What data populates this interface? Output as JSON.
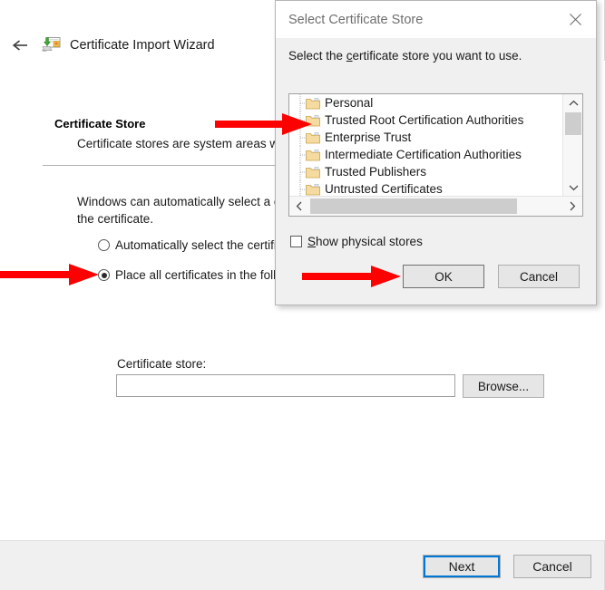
{
  "wizard": {
    "title": "Certificate Import Wizard",
    "back_icon": "back-arrow-icon",
    "app_icon": "certificate-import-icon",
    "heading": "Certificate Store",
    "subtext": "Certificate stores are system areas w",
    "intro_text": "Windows can automatically select a c\nthe certificate.",
    "radios": [
      {
        "label": "Automatically select the certifi",
        "checked": false
      },
      {
        "label": "Place all certificates in the follo",
        "checked": true
      }
    ],
    "cert_store_label": "Certificate store:",
    "cert_store_value": "",
    "cert_store_placeholder": "",
    "browse_label": "Browse...",
    "footer": {
      "next_label": "Next",
      "cancel_label": "Cancel"
    }
  },
  "dialog": {
    "title": "Select Certificate Store",
    "close_icon": "close-icon",
    "instruction_before": "Select the ",
    "instruction_accel": "c",
    "instruction_after": "ertificate store you want to use.",
    "tree_items": [
      {
        "label": "Personal",
        "icon": "folder-icon"
      },
      {
        "label": "Trusted Root Certification Authorities",
        "icon": "folder-icon"
      },
      {
        "label": "Enterprise Trust",
        "icon": "folder-icon"
      },
      {
        "label": "Intermediate Certification Authorities",
        "icon": "folder-icon"
      },
      {
        "label": "Trusted Publishers",
        "icon": "folder-icon"
      },
      {
        "label": "Untrusted Certificates",
        "icon": "folder-icon"
      }
    ],
    "scroll_up_icon": "chevron-up-icon",
    "scroll_down_icon": "chevron-down-icon",
    "scroll_left_icon": "chevron-left-icon",
    "scroll_right_icon": "chevron-right-icon",
    "show_physical_accel": "S",
    "show_physical_rest": "how physical stores",
    "show_physical_checked": false,
    "ok_label": "OK",
    "cancel_label": "Cancel"
  },
  "annotations": {
    "arrow_color": "#FF0000",
    "arrows": [
      {
        "name": "arrow-to-trusted-root"
      },
      {
        "name": "arrow-to-place-all-radio"
      },
      {
        "name": "arrow-to-ok-button"
      }
    ]
  }
}
